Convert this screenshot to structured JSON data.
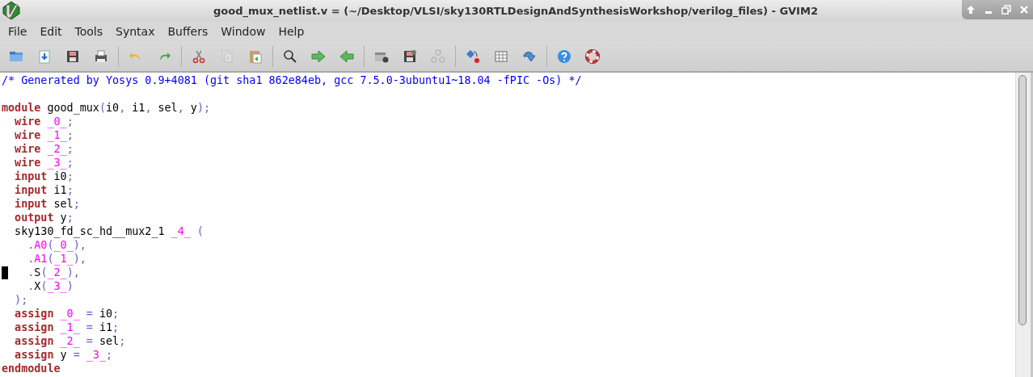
{
  "window": {
    "title": "good_mux_netlist.v = (~/Desktop/VLSI/sky130RTLDesignAndSynthesisWorkshop/verilog_files) - GVIM2"
  },
  "menu": [
    "File",
    "Edit",
    "Tools",
    "Syntax",
    "Buffers",
    "Window",
    "Help"
  ],
  "toolbar": [
    {
      "kind": "open",
      "disabled": false
    },
    {
      "kind": "load",
      "disabled": false
    },
    {
      "kind": "save",
      "disabled": false
    },
    {
      "kind": "print",
      "disabled": false
    },
    {
      "kind": "sep"
    },
    {
      "kind": "undo",
      "disabled": false
    },
    {
      "kind": "redo",
      "disabled": false
    },
    {
      "kind": "sep"
    },
    {
      "kind": "cut",
      "disabled": false
    },
    {
      "kind": "copy",
      "disabled": true
    },
    {
      "kind": "paste",
      "disabled": false
    },
    {
      "kind": "sep"
    },
    {
      "kind": "find",
      "disabled": false
    },
    {
      "kind": "next",
      "disabled": false
    },
    {
      "kind": "prev",
      "disabled": false
    },
    {
      "kind": "sep"
    },
    {
      "kind": "session-load",
      "disabled": false
    },
    {
      "kind": "session-save",
      "disabled": false
    },
    {
      "kind": "script",
      "disabled": true
    },
    {
      "kind": "sep"
    },
    {
      "kind": "make",
      "disabled": false
    },
    {
      "kind": "table",
      "disabled": false
    },
    {
      "kind": "jump",
      "disabled": false
    },
    {
      "kind": "sep"
    },
    {
      "kind": "help",
      "disabled": false
    },
    {
      "kind": "lifebuoy",
      "disabled": false
    }
  ],
  "lines": [
    {
      "kind": "code",
      "cursor": false,
      "tokens": [
        {
          "kind": "com",
          "text": "/* Generated by Yosys 0.9+4081 (git sha1 862e84eb, gcc 7.5.0-3ubuntu1~18.04 -fPIC -Os) */"
        }
      ]
    },
    {
      "kind": "blank"
    },
    {
      "kind": "code",
      "cursor": false,
      "tokens": [
        {
          "kind": "kw",
          "text": "module"
        },
        {
          "kind": "id",
          "text": " good_mux"
        },
        {
          "kind": "p",
          "text": "("
        },
        {
          "kind": "id",
          "text": "i0"
        },
        {
          "kind": "p",
          "text": ", "
        },
        {
          "kind": "id",
          "text": "i1"
        },
        {
          "kind": "p",
          "text": ", "
        },
        {
          "kind": "id",
          "text": "sel"
        },
        {
          "kind": "p",
          "text": ", "
        },
        {
          "kind": "id",
          "text": "y"
        },
        {
          "kind": "p",
          "text": ");"
        }
      ]
    },
    {
      "kind": "code",
      "cursor": false,
      "tokens": [
        {
          "kind": "kw",
          "text": "  wire "
        },
        {
          "kind": "num",
          "text": "_0_"
        },
        {
          "kind": "p",
          "text": ";"
        }
      ]
    },
    {
      "kind": "code",
      "cursor": false,
      "tokens": [
        {
          "kind": "kw",
          "text": "  wire "
        },
        {
          "kind": "num",
          "text": "_1_"
        },
        {
          "kind": "p",
          "text": ";"
        }
      ]
    },
    {
      "kind": "code",
      "cursor": false,
      "tokens": [
        {
          "kind": "kw",
          "text": "  wire "
        },
        {
          "kind": "num",
          "text": "_2_"
        },
        {
          "kind": "p",
          "text": ";"
        }
      ]
    },
    {
      "kind": "code",
      "cursor": false,
      "tokens": [
        {
          "kind": "kw",
          "text": "  wire "
        },
        {
          "kind": "num",
          "text": "_3_"
        },
        {
          "kind": "p",
          "text": ";"
        }
      ]
    },
    {
      "kind": "code",
      "cursor": false,
      "tokens": [
        {
          "kind": "kw",
          "text": "  input "
        },
        {
          "kind": "id",
          "text": "i0"
        },
        {
          "kind": "p",
          "text": ";"
        }
      ]
    },
    {
      "kind": "code",
      "cursor": false,
      "tokens": [
        {
          "kind": "kw",
          "text": "  input "
        },
        {
          "kind": "id",
          "text": "i1"
        },
        {
          "kind": "p",
          "text": ";"
        }
      ]
    },
    {
      "kind": "code",
      "cursor": false,
      "tokens": [
        {
          "kind": "kw",
          "text": "  input "
        },
        {
          "kind": "id",
          "text": "sel"
        },
        {
          "kind": "p",
          "text": ";"
        }
      ]
    },
    {
      "kind": "code",
      "cursor": false,
      "tokens": [
        {
          "kind": "kw",
          "text": "  output "
        },
        {
          "kind": "id",
          "text": "y"
        },
        {
          "kind": "p",
          "text": ";"
        }
      ]
    },
    {
      "kind": "code",
      "cursor": false,
      "tokens": [
        {
          "kind": "id",
          "text": "  sky130_fd_sc_hd__mux2_1 "
        },
        {
          "kind": "num",
          "text": "_4_"
        },
        {
          "kind": "p",
          "text": " ("
        }
      ]
    },
    {
      "kind": "code",
      "cursor": false,
      "tokens": [
        {
          "kind": "p",
          "text": "    ."
        },
        {
          "kind": "num",
          "text": "A0"
        },
        {
          "kind": "p",
          "text": "("
        },
        {
          "kind": "num",
          "text": "_0_"
        },
        {
          "kind": "p",
          "text": "),"
        }
      ]
    },
    {
      "kind": "code",
      "cursor": false,
      "tokens": [
        {
          "kind": "p",
          "text": "    ."
        },
        {
          "kind": "num",
          "text": "A1"
        },
        {
          "kind": "p",
          "text": "("
        },
        {
          "kind": "num",
          "text": "_1_"
        },
        {
          "kind": "p",
          "text": "),"
        }
      ]
    },
    {
      "kind": "code",
      "cursor": true,
      "tokens": [
        {
          "kind": "p",
          "text": "    ."
        },
        {
          "kind": "id",
          "text": "S"
        },
        {
          "kind": "p",
          "text": "("
        },
        {
          "kind": "num",
          "text": "_2_"
        },
        {
          "kind": "p",
          "text": "),"
        }
      ]
    },
    {
      "kind": "code",
      "cursor": false,
      "tokens": [
        {
          "kind": "p",
          "text": "    ."
        },
        {
          "kind": "id",
          "text": "X"
        },
        {
          "kind": "p",
          "text": "("
        },
        {
          "kind": "num",
          "text": "_3_"
        },
        {
          "kind": "p",
          "text": ")"
        }
      ]
    },
    {
      "kind": "code",
      "cursor": false,
      "tokens": [
        {
          "kind": "p",
          "text": "  );"
        }
      ]
    },
    {
      "kind": "code",
      "cursor": false,
      "tokens": [
        {
          "kind": "kw",
          "text": "  assign "
        },
        {
          "kind": "num",
          "text": "_0_"
        },
        {
          "kind": "p",
          "text": " = "
        },
        {
          "kind": "id",
          "text": "i0"
        },
        {
          "kind": "p",
          "text": ";"
        }
      ]
    },
    {
      "kind": "code",
      "cursor": false,
      "tokens": [
        {
          "kind": "kw",
          "text": "  assign "
        },
        {
          "kind": "num",
          "text": "_1_"
        },
        {
          "kind": "p",
          "text": " = "
        },
        {
          "kind": "id",
          "text": "i1"
        },
        {
          "kind": "p",
          "text": ";"
        }
      ]
    },
    {
      "kind": "code",
      "cursor": false,
      "tokens": [
        {
          "kind": "kw",
          "text": "  assign "
        },
        {
          "kind": "num",
          "text": "_2_"
        },
        {
          "kind": "p",
          "text": " = "
        },
        {
          "kind": "id",
          "text": "sel"
        },
        {
          "kind": "p",
          "text": ";"
        }
      ]
    },
    {
      "kind": "code",
      "cursor": false,
      "tokens": [
        {
          "kind": "kw",
          "text": "  assign "
        },
        {
          "kind": "id",
          "text": "y"
        },
        {
          "kind": "p",
          "text": " = "
        },
        {
          "kind": "num",
          "text": "_3_"
        },
        {
          "kind": "p",
          "text": ";"
        }
      ]
    },
    {
      "kind": "code",
      "cursor": false,
      "tokens": [
        {
          "kind": "kw",
          "text": "endmodule"
        }
      ]
    }
  ]
}
